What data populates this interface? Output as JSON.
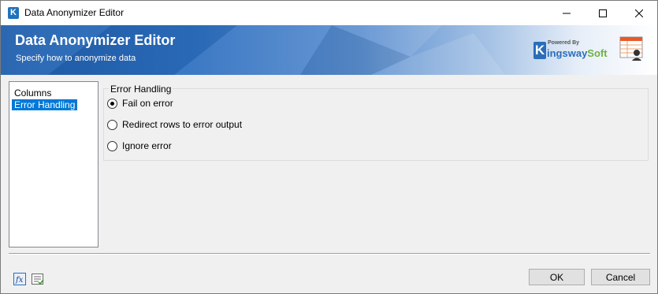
{
  "window": {
    "title": "Data Anonymizer Editor",
    "app_icon": "K",
    "controls": [
      "minimize-icon",
      "maximize-icon",
      "close-icon"
    ]
  },
  "banner": {
    "title": "Data Anonymizer Editor",
    "subtitle": "Specify how to anonymize data",
    "brand_powered": "Powered By",
    "brand_k": "K",
    "brand_name_a": "ingsway",
    "brand_name_b": "Soft",
    "brand_colors": {
      "blue": "#2a6ebb",
      "green": "#6db33f"
    }
  },
  "nav": {
    "items": [
      {
        "label": "Columns",
        "selected": false
      },
      {
        "label": "Error Handling",
        "selected": true
      }
    ]
  },
  "error_handling": {
    "group_label": "Error Handling",
    "options": [
      {
        "label": "Fail on error",
        "checked": true
      },
      {
        "label": "Redirect rows to error output",
        "checked": false
      },
      {
        "label": "Ignore error",
        "checked": false
      }
    ]
  },
  "footer": {
    "tools": [
      "fx-expression-icon",
      "properties-icon"
    ],
    "ok_label": "OK",
    "cancel_label": "Cancel"
  },
  "colors": {
    "selection": "#0078d7",
    "banner_blue": "#1f5fae"
  }
}
